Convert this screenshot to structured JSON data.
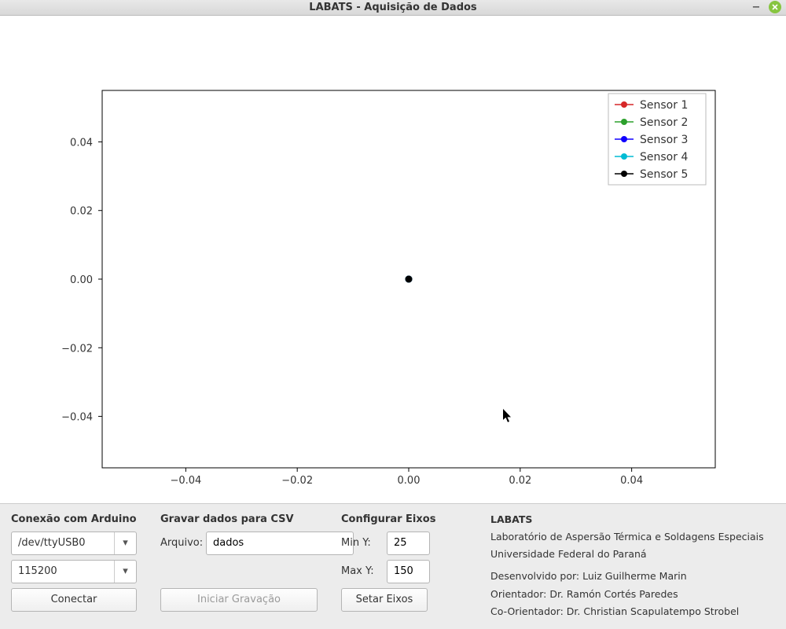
{
  "window": {
    "title": "LABATS - Aquisição de Dados"
  },
  "chart_data": {
    "type": "scatter",
    "series": [
      {
        "name": "Sensor 1",
        "color": "#d62728",
        "x": [
          0
        ],
        "y": [
          0
        ]
      },
      {
        "name": "Sensor 2",
        "color": "#2ca02c",
        "x": [
          0
        ],
        "y": [
          0
        ]
      },
      {
        "name": "Sensor 3",
        "color": "#1000ff",
        "x": [
          0
        ],
        "y": [
          0
        ]
      },
      {
        "name": "Sensor 4",
        "color": "#00bcd4",
        "x": [
          0
        ],
        "y": [
          0
        ]
      },
      {
        "name": "Sensor 5",
        "color": "#000000",
        "x": [
          0
        ],
        "y": [
          0
        ]
      }
    ],
    "xlim": [
      -0.055,
      0.055
    ],
    "ylim": [
      -0.055,
      0.055
    ],
    "xticks": [
      -0.04,
      -0.02,
      0.0,
      0.02,
      0.04
    ],
    "yticks": [
      -0.04,
      -0.02,
      0.0,
      0.02,
      0.04
    ],
    "xticklabels": [
      "−0.04",
      "−0.02",
      "0.00",
      "0.02",
      "0.04"
    ],
    "yticklabels": [
      "−0.04",
      "−0.02",
      "0.00",
      "0.02",
      "0.04"
    ],
    "title": "",
    "xlabel": "",
    "ylabel": ""
  },
  "panel": {
    "conn": {
      "heading": "Conexão com Arduino",
      "port": "/dev/ttyUSB0",
      "baud": "115200",
      "connect_label": "Conectar"
    },
    "csv": {
      "heading": "Gravar dados para CSV",
      "file_label": "Arquivo:",
      "file_value": "dados",
      "start_label": "Iniciar Gravação"
    },
    "axes": {
      "heading": "Configurar Eixos",
      "miny_label": "Min Y:",
      "miny_value": "25",
      "maxy_label": "Max Y:",
      "maxy_value": "150",
      "set_label": "Setar Eixos"
    },
    "about": {
      "title": "LABATS",
      "line1": "Laboratório de Aspersão Térmica e Soldagens Especiais",
      "line2": "Universidade Federal do Paraná",
      "dev_label": "Desenvolvido por: ",
      "dev_name": "Luiz Guilherme Marin",
      "orient_label": "Orientador: ",
      "orient_name": "Dr. Ramón Cortés Paredes",
      "coorient_label": "Co-Orientador: ",
      "coorient_name": "Dr. Christian Scapulatempo Strobel"
    }
  }
}
